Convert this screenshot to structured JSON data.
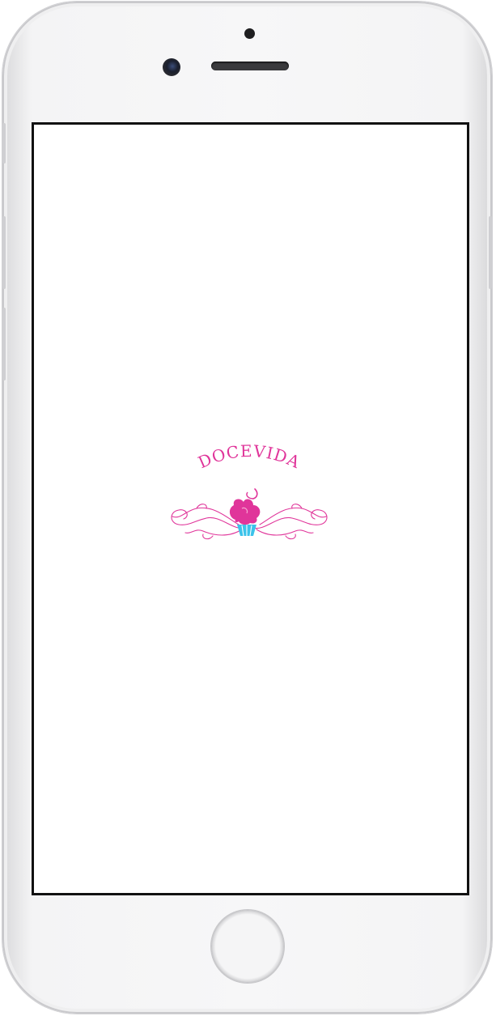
{
  "splash": {
    "brand_name": "DOCEVIDA",
    "logo_icon": "cupcake-icon",
    "brand_color": "#e0359a",
    "accent_color": "#3cc3ea"
  },
  "device": {
    "frame_color": "#f4f4f5",
    "screen_border_color": "#111111"
  }
}
